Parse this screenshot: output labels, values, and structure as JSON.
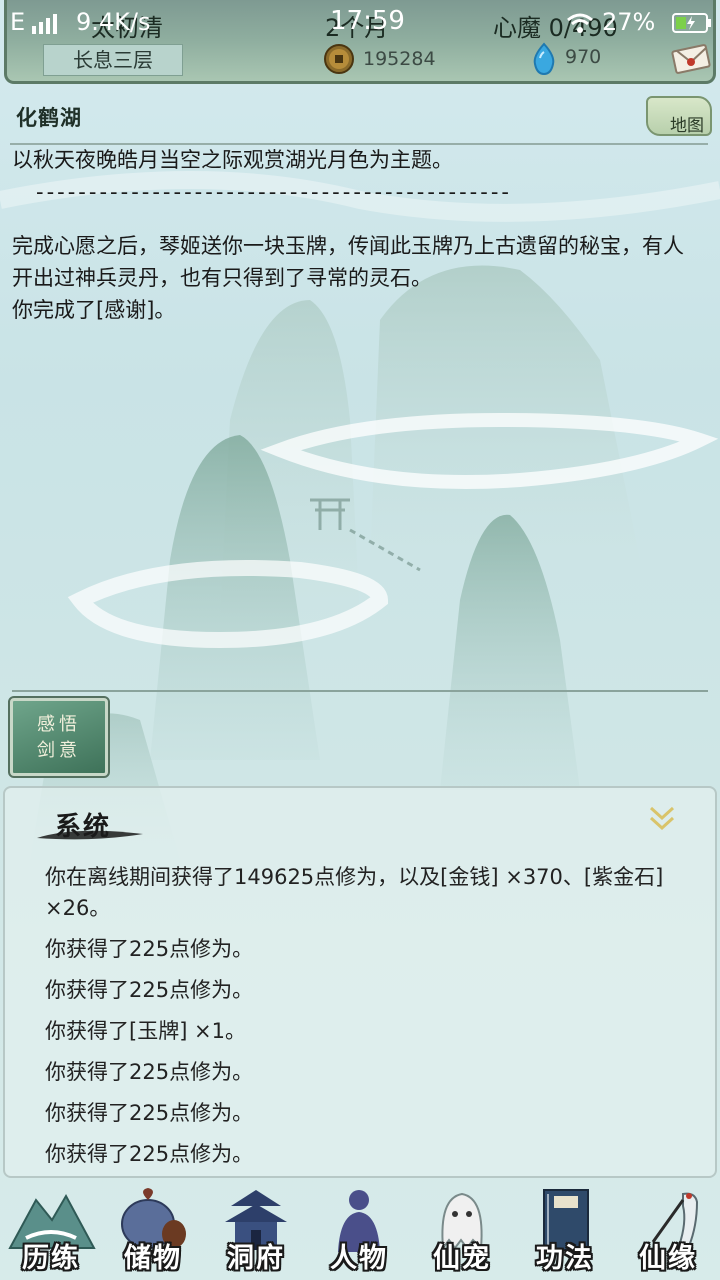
{
  "status_bar": {
    "network": "E",
    "speed": "9.4K/s",
    "time": "17:59",
    "battery": "27%",
    "status_text_left": "太初清",
    "status_text_mid": "2个月",
    "status_text_right": "心魔 0/490"
  },
  "header": {
    "realm": "长息三层",
    "coins": "195284",
    "gems": "970"
  },
  "location": {
    "title": "化鹤湖",
    "map_button": "地图"
  },
  "story": {
    "line1": "以秋天夜晚皓月当空之际观赏湖光月色为主题。",
    "dashes": "---------------------------------------------",
    "paragraph": "完成心愿之后，琴姬送你一块玉牌，传闻此玉牌乃上古遗留的秘宝，有人开出过神兵灵丹，也有只得到了寻常的灵石。",
    "completion": "你完成了[感谢]。"
  },
  "skill_button": {
    "line1": "感悟",
    "line2": "剑意"
  },
  "system": {
    "title": "系统",
    "log": [
      "你在离线期间获得了149625点修为，以及[金钱] ×370、[紫金石] ×26。",
      "你获得了225点修为。",
      "你获得了225点修为。",
      "你获得了[玉牌] ×1。",
      "你获得了225点修为。",
      "你获得了225点修为。",
      "你获得了225点修为。"
    ]
  },
  "nav": [
    {
      "label": "历练",
      "icon": "mountain-icon"
    },
    {
      "label": "储物",
      "icon": "bag-icon"
    },
    {
      "label": "洞府",
      "icon": "pavilion-icon"
    },
    {
      "label": "人物",
      "icon": "person-icon"
    },
    {
      "label": "仙宠",
      "icon": "ghost-pet-icon"
    },
    {
      "label": "功法",
      "icon": "book-icon"
    },
    {
      "label": "仙缘",
      "icon": "crane-icon"
    }
  ],
  "colors": {
    "header_green": "#8fae9f",
    "skill_button": "#4f8a6e",
    "accent_gold": "#d9c46a"
  }
}
